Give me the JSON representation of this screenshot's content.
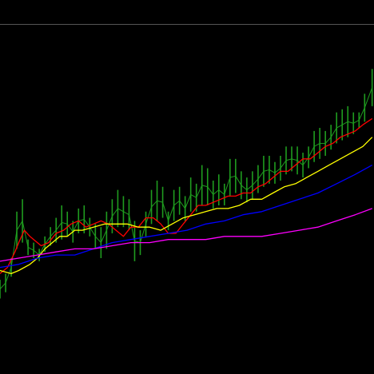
{
  "chart_data": {
    "type": "line",
    "title": "",
    "xlabel": "",
    "ylabel": "",
    "background": "#000000",
    "frame_line_color": "#555555",
    "grid": false,
    "legend": "none",
    "x_range": [
      0,
      100
    ],
    "y_range": [
      0,
      100
    ],
    "price": {
      "name": "",
      "color": "#1f9c1f",
      "style": "hl-bars",
      "x": [
        0,
        1.5,
        3,
        4.5,
        6,
        7.5,
        9,
        10.5,
        12,
        13.5,
        15,
        16.5,
        18,
        19.5,
        21,
        22.5,
        24,
        25.5,
        27,
        28.5,
        30,
        31.5,
        33,
        34.5,
        36,
        37.5,
        39,
        40.5,
        42,
        43.5,
        45,
        46.5,
        48,
        49.5,
        51,
        52.5,
        54,
        55.5,
        57,
        58.5,
        60,
        61.5,
        63,
        64.5,
        66,
        67.5,
        69,
        70.5,
        72,
        73.5,
        75,
        76.5,
        78,
        79.5,
        81,
        82.5,
        84,
        85.5,
        87,
        88.5,
        90,
        91.5,
        93,
        94.5,
        96,
        97.5,
        99.5
      ],
      "high": [
        18,
        20,
        25,
        40,
        44,
        31,
        30,
        28,
        32,
        35,
        38,
        42,
        40,
        37,
        41,
        42,
        38,
        36,
        35,
        40,
        44,
        47,
        45,
        44,
        37,
        34,
        40,
        47,
        50,
        48,
        40,
        47,
        48,
        45,
        51,
        49,
        55,
        54,
        50,
        52,
        49,
        57,
        57,
        53,
        51,
        53,
        55,
        58,
        58,
        56,
        58,
        61,
        61,
        61,
        59,
        61,
        66,
        67,
        66,
        68,
        72,
        73,
        74,
        72,
        72,
        78,
        86
      ],
      "low": [
        12,
        14,
        19,
        28,
        30,
        26,
        25,
        24,
        27,
        29,
        30,
        31,
        32,
        30,
        33,
        33,
        32,
        28,
        25,
        28,
        33,
        35,
        35,
        34,
        24,
        26,
        32,
        36,
        37,
        38,
        34,
        37,
        39,
        37,
        40,
        40,
        42,
        42,
        41,
        42,
        42,
        45,
        46,
        44,
        43,
        44,
        46,
        48,
        49,
        49,
        50,
        52,
        53,
        52,
        51,
        54,
        56,
        57,
        58,
        60,
        62,
        63,
        64,
        65,
        67,
        69,
        74
      ]
    },
    "series": [
      {
        "name": "",
        "color": "#ff0000",
        "x": [
          0,
          2,
          4,
          5,
          6.5,
          8,
          9,
          11,
          13,
          15,
          17,
          19,
          21,
          23,
          25,
          27,
          29,
          31,
          33,
          35,
          37,
          39,
          41,
          43,
          45,
          47,
          49,
          51,
          53,
          55,
          57,
          59,
          61,
          63,
          65,
          67,
          69,
          71,
          73,
          75,
          77,
          79,
          81,
          83,
          85,
          87,
          89,
          91,
          93,
          95,
          97,
          99.5
        ],
        "y": [
          20,
          22,
          27,
          30,
          34,
          32,
          31,
          29,
          30,
          33,
          34,
          36,
          37,
          35,
          36,
          37,
          36,
          34,
          32,
          35,
          35,
          38,
          38,
          36,
          33,
          33,
          36,
          39,
          42,
          42,
          43,
          44,
          45,
          45,
          46,
          46,
          48,
          49,
          51,
          53,
          53,
          55,
          57,
          57,
          59,
          61,
          62,
          64,
          65,
          66,
          68,
          70
        ]
      },
      {
        "name": "",
        "color": "#ffff00",
        "x": [
          0,
          3,
          5,
          8,
          10,
          12,
          14,
          16,
          18,
          20,
          22,
          25,
          28,
          31,
          34,
          37,
          40,
          43,
          46,
          49,
          52,
          55,
          58,
          61,
          64,
          67,
          70,
          73,
          76,
          79,
          82,
          85,
          88,
          91,
          94,
          97,
          99.5
        ],
        "y": [
          21,
          20,
          21,
          23,
          25,
          28,
          30,
          32,
          32,
          34,
          34,
          35,
          36,
          36,
          36,
          35,
          35,
          34,
          36,
          38,
          39,
          40,
          41,
          41,
          42,
          44,
          44,
          46,
          48,
          49,
          51,
          53,
          55,
          57,
          59,
          61,
          64
        ]
      },
      {
        "name": "",
        "color": "#0000ff",
        "x": [
          0,
          5,
          10,
          15,
          20,
          25,
          30,
          35,
          40,
          45,
          50,
          55,
          60,
          65,
          70,
          75,
          80,
          85,
          90,
          95,
          99.5
        ],
        "y": [
          22,
          23,
          25,
          26,
          26,
          28,
          30,
          31,
          32,
          33,
          34,
          36,
          37,
          39,
          40,
          42,
          44,
          46,
          49,
          52,
          55
        ]
      },
      {
        "name": "",
        "color": "#ff00ff",
        "x": [
          0,
          5,
          10,
          15,
          20,
          25,
          30,
          35,
          40,
          45,
          50,
          55,
          60,
          65,
          70,
          75,
          80,
          85,
          90,
          95,
          99.5
        ],
        "y": [
          24,
          25,
          26,
          27,
          28,
          28,
          29,
          30,
          30,
          31,
          31,
          31,
          32,
          32,
          32,
          33,
          34,
          35,
          37,
          39,
          41
        ]
      }
    ]
  }
}
